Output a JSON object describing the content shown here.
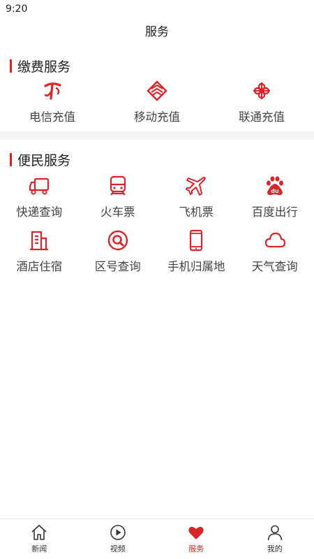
{
  "status_bar": {
    "time": "9:20"
  },
  "header": {
    "title": "服务"
  },
  "pay_section": {
    "title": "缴费服务",
    "items": [
      {
        "label": "电信充值",
        "icon": "china-telecom-icon"
      },
      {
        "label": "移动充值",
        "icon": "china-mobile-icon"
      },
      {
        "label": "联通充值",
        "icon": "china-unicom-icon"
      }
    ]
  },
  "convenience_section": {
    "title": "便民服务",
    "items": [
      {
        "label": "快递查询",
        "icon": "truck-icon"
      },
      {
        "label": "火车票",
        "icon": "train-icon"
      },
      {
        "label": "飞机票",
        "icon": "airplane-icon"
      },
      {
        "label": "百度出行",
        "icon": "baidu-icon"
      },
      {
        "label": "酒店住宿",
        "icon": "hotel-icon"
      },
      {
        "label": "区号查询",
        "icon": "search-icon"
      },
      {
        "label": "手机归属地",
        "icon": "phone-icon"
      },
      {
        "label": "天气查询",
        "icon": "cloud-icon"
      }
    ]
  },
  "tabbar": {
    "tabs": [
      {
        "label": "新闻",
        "icon": "home-icon",
        "active": false
      },
      {
        "label": "视频",
        "icon": "play-icon",
        "active": false
      },
      {
        "label": "服务",
        "icon": "heart-icon",
        "active": true
      },
      {
        "label": "我的",
        "icon": "user-icon",
        "active": false
      }
    ]
  },
  "colors": {
    "accent": "#d8262a",
    "divider": "#f4f4f4"
  }
}
